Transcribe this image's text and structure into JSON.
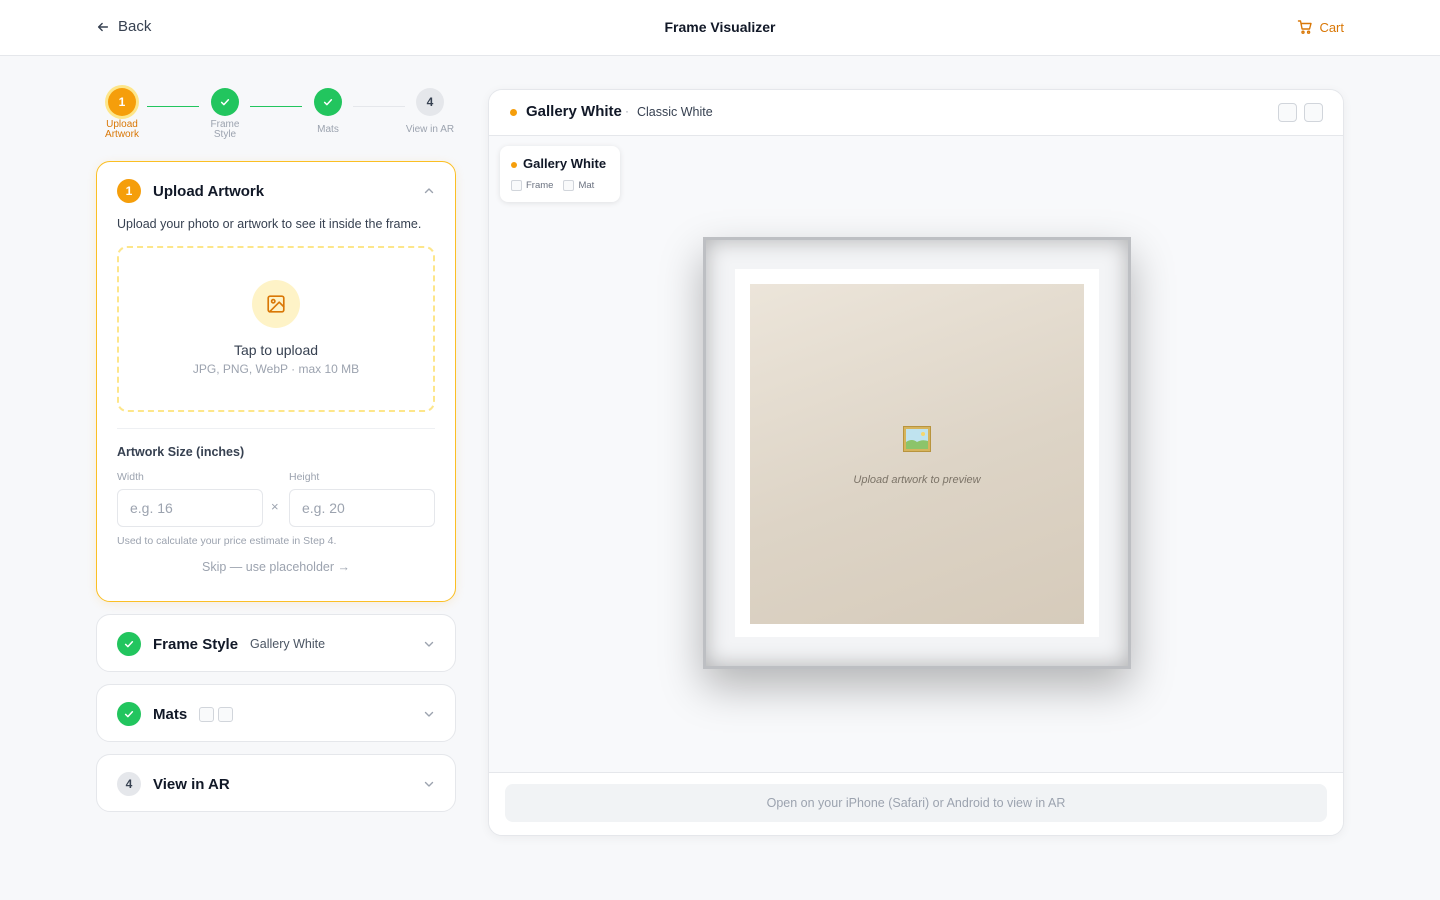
{
  "topbar": {
    "back_label": "Back",
    "title": "Frame Visualizer",
    "cart_label": "Cart"
  },
  "stepper": {
    "steps": [
      {
        "label_1": "Upload",
        "label_2": "Artwork",
        "number": "1",
        "state": "active"
      },
      {
        "label_1": "Frame",
        "label_2": "Style",
        "number": "2",
        "state": "done"
      },
      {
        "label_1": "Mats",
        "label_2": "",
        "number": "3",
        "state": "done"
      },
      {
        "label_1": "View in AR",
        "label_2": "",
        "number": "4",
        "state": "todo"
      }
    ]
  },
  "upload_card": {
    "number": "1",
    "title": "Upload Artwork",
    "description": "Upload your photo or artwork to see it inside the frame.",
    "drop_title": "Tap to upload",
    "drop_hint": "JPG, PNG, WebP · max 10 MB",
    "size_title": "Artwork Size (inches)",
    "width_label": "Width",
    "width_placeholder": "e.g. 16",
    "height_label": "Height",
    "height_placeholder": "e.g. 20",
    "times": "×",
    "note": "Used to calculate your price estimate in Step 4.",
    "skip_label": "Skip — use placeholder →"
  },
  "frame_card": {
    "title": "Frame Style",
    "value": "Gallery White"
  },
  "mats_card": {
    "title": "Mats"
  },
  "ar_card": {
    "number": "4",
    "title": "View in AR"
  },
  "preview": {
    "frame_name": "Gallery White",
    "separator": "·",
    "frame_sub": "Classic White",
    "chip": {
      "name": "Gallery White",
      "frame_label": "Frame",
      "mat_label": "Mat"
    },
    "placeholder_text": "Upload artwork to preview",
    "ar_message": "Open on your iPhone (Safari) or Android to view in AR"
  },
  "colors": {
    "accent": "#f59e0b",
    "success": "#22c55e"
  }
}
